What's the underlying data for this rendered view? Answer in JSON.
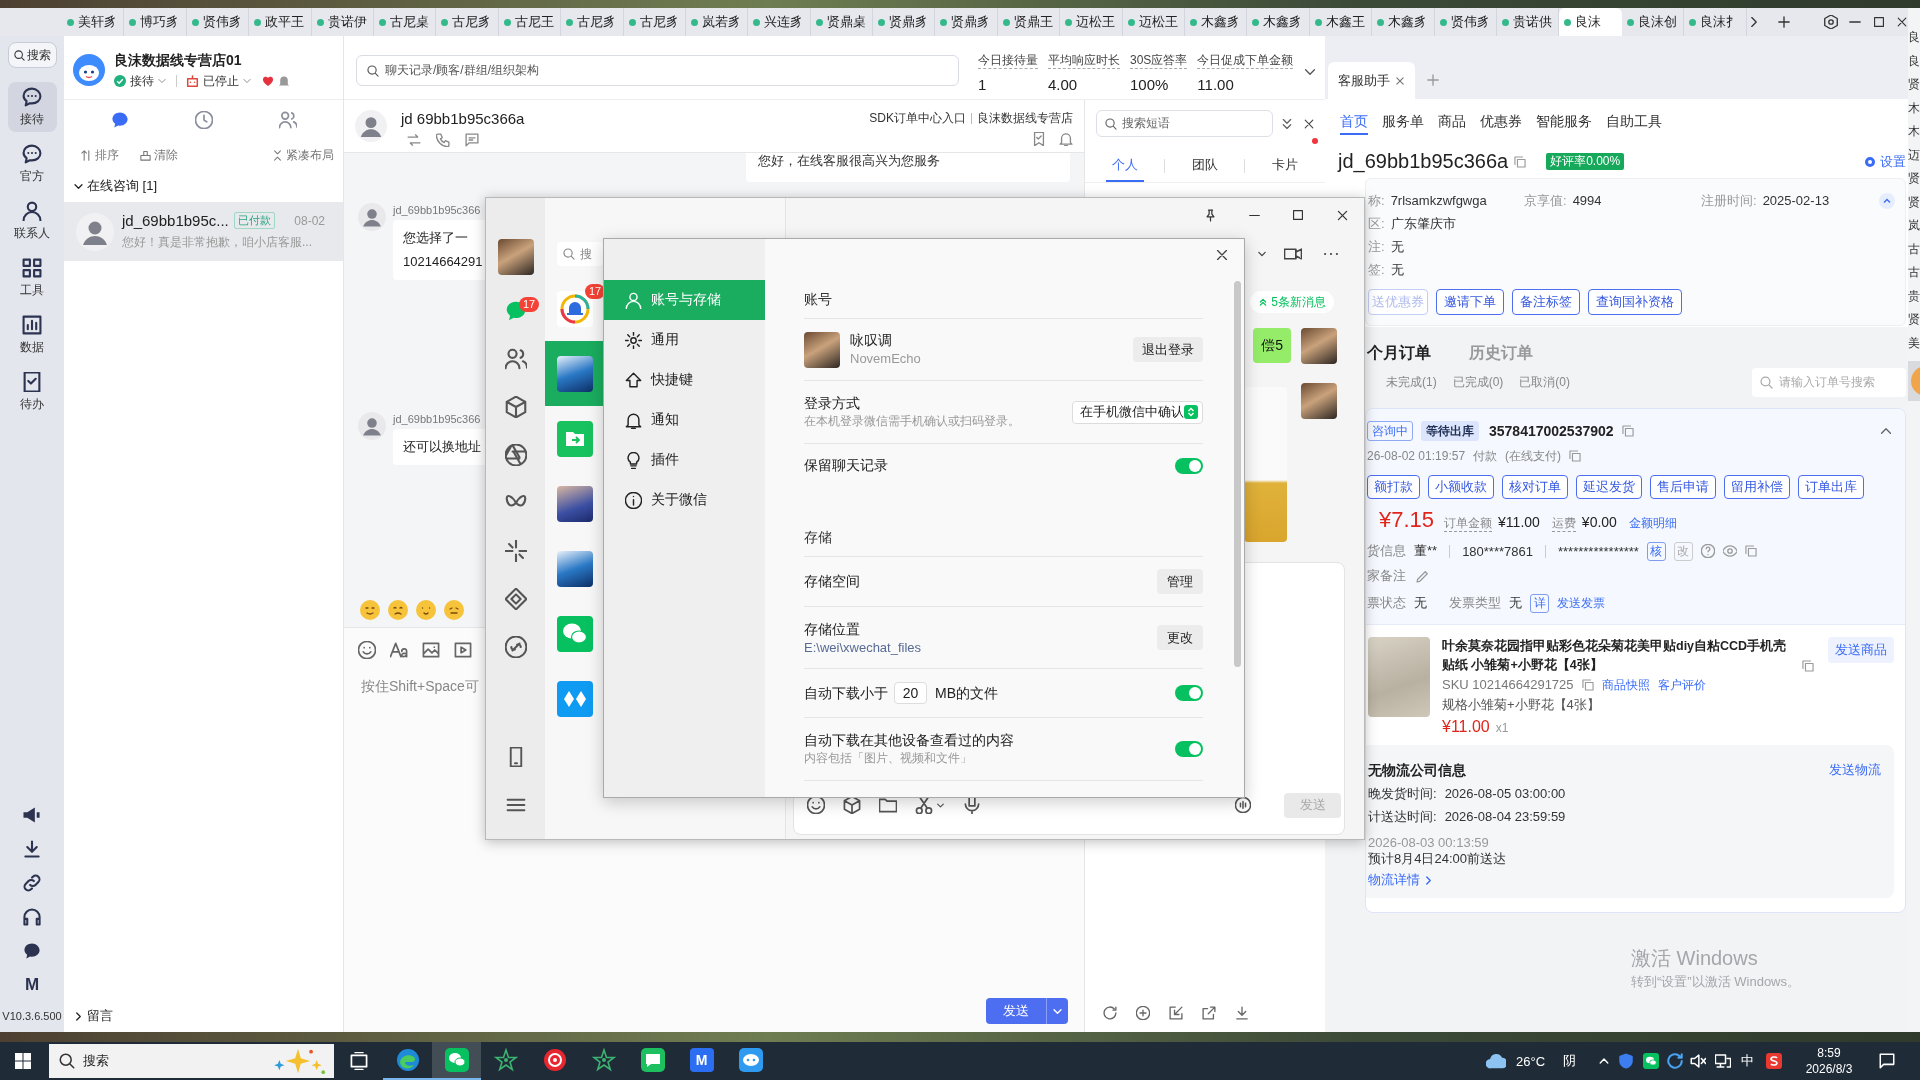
{
  "top_tabs": [
    {
      "label": "美轩豸",
      "selected": false
    },
    {
      "label": "博巧豸",
      "selected": false
    },
    {
      "label": "贤伟豸",
      "selected": false
    },
    {
      "label": "政平王",
      "selected": false
    },
    {
      "label": "贵诺伊",
      "selected": false
    },
    {
      "label": "古尼桌",
      "selected": false
    },
    {
      "label": "古尼豸",
      "selected": false
    },
    {
      "label": "古尼王",
      "selected": false
    },
    {
      "label": "古尼豸",
      "selected": false
    },
    {
      "label": "古尼豸",
      "selected": false
    },
    {
      "label": "岚若豸",
      "selected": false
    },
    {
      "label": "兴连豸",
      "selected": false
    },
    {
      "label": "贤鼎桌",
      "selected": false
    },
    {
      "label": "贤鼎豸",
      "selected": false
    },
    {
      "label": "贤鼎豸",
      "selected": false
    },
    {
      "label": "贤鼎王",
      "selected": false
    },
    {
      "label": "迈松王",
      "selected": false
    },
    {
      "label": "迈松王",
      "selected": false
    },
    {
      "label": "木鑫豸",
      "selected": false
    },
    {
      "label": "木鑫豸",
      "selected": false
    },
    {
      "label": "木鑫王",
      "selected": false
    },
    {
      "label": "木鑫豸",
      "selected": false
    },
    {
      "label": "贤伟豸",
      "selected": false
    },
    {
      "label": "贵诺供",
      "selected": false
    },
    {
      "label": "良沫",
      "selected": true
    },
    {
      "label": "良沫创",
      "selected": false
    },
    {
      "label": "良沫扌",
      "selected": false
    }
  ],
  "nav": {
    "search": "搜索",
    "items": [
      {
        "label": "接待",
        "selected": true
      },
      {
        "label": "官方",
        "selected": false
      },
      {
        "label": "联系人",
        "selected": false
      },
      {
        "label": "工具",
        "selected": false
      },
      {
        "label": "数据",
        "selected": false
      },
      {
        "label": "待办",
        "selected": false
      }
    ],
    "mark": "M",
    "version": "V10.3.6.500"
  },
  "store": {
    "name": "良沫数据线专营店01",
    "reception": "接待",
    "robot": "已停止"
  },
  "conversation_tabs": [
    {
      "selected": true
    },
    {
      "selected": false
    },
    {
      "selected": false
    }
  ],
  "list_actions": [
    "排序",
    "清除",
    "紧凑布局"
  ],
  "groups": [
    {
      "title": "在线咨询 [1]",
      "expanded": true,
      "conversations": [
        {
          "name": "jd_69bb1b95c...",
          "tag": "已付款",
          "date": "08-02",
          "preview": "您好！真是非常抱歉，咱小店客服...",
          "selected": true
        }
      ]
    },
    {
      "title": "留言",
      "expanded": false
    }
  ],
  "workbench": {
    "search_placeholder": "聊天记录/顾客/群组/组织架构",
    "metrics": [
      {
        "label": "今日接待量",
        "value": "1"
      },
      {
        "label": "平均响应时长",
        "value": "4.00"
      },
      {
        "label": "30S应答率",
        "value": "100%"
      },
      {
        "label": "今日促成下单金额",
        "value": "11.00"
      }
    ]
  },
  "chat": {
    "customer": "jd 69bb1b95c366a",
    "links": [
      "SDK订单中心入口",
      "良沫数据线专营店"
    ],
    "messages": [
      {
        "kind": "agent",
        "lines": [
          "您好，在线客服很高兴为您服务"
        ]
      },
      {
        "kind": "customer",
        "sender": "jd_69bb1b95c366",
        "lines": [
          "您选择了一",
          "10214664291"
        ]
      },
      {
        "kind": "customer",
        "sender": "jd_69bb1b95c366",
        "lines": [
          "还可以换地址"
        ]
      }
    ],
    "placeholder": "按住Shift+Space可",
    "send": "发送"
  },
  "phrases": {
    "placeholder": "搜索短语",
    "tabs": [
      {
        "label": "个人",
        "selected": true,
        "dot": false
      },
      {
        "label": "团队",
        "selected": false,
        "dot": false
      },
      {
        "label": "卡片",
        "selected": false,
        "dot": true
      }
    ]
  },
  "assistant": {
    "tabs": [
      {
        "label": "客服助手",
        "selected": true
      }
    ],
    "nav": [
      {
        "label": "首页",
        "selected": true
      },
      {
        "label": "服务单",
        "selected": false
      },
      {
        "label": "商品",
        "selected": false
      },
      {
        "label": "优惠券",
        "selected": false
      },
      {
        "label": "智能服务",
        "selected": false
      },
      {
        "label": "自助工具",
        "selected": false
      }
    ],
    "customer_id": "jd_69bb1b95c366a",
    "rating": "好评率0.00%",
    "setting": {
      "label": "设置",
      "on": true
    },
    "info_rows": [
      [
        {
          "label": "称:",
          "value": "7rlsamkzwfgwga"
        },
        {
          "label": "京享值:",
          "value": "4994"
        },
        {
          "label": "注册时间:",
          "value": "2025-02-13"
        }
      ],
      [
        {
          "label": "区:",
          "value": "广东肇庆市"
        }
      ],
      [
        {
          "label": "注:",
          "value": "无"
        }
      ],
      [
        {
          "label": "签:",
          "value": "无"
        }
      ]
    ],
    "info_expanded": true,
    "actions": [
      {
        "label": "送优惠券",
        "disabled": true
      },
      {
        "label": "邀请下单",
        "disabled": false
      },
      {
        "label": "备注标签",
        "disabled": false
      },
      {
        "label": "查询国补资格",
        "disabled": false
      }
    ],
    "order_tabs": [
      {
        "label": "个月订单",
        "selected": true
      },
      {
        "label": "历史订单",
        "selected": false
      }
    ],
    "order_filters": [
      {
        "label": "未完成(1)",
        "selected": false
      },
      {
        "label": "已完成(0)",
        "selected": false
      },
      {
        "label": "已取消(0)",
        "selected": false
      }
    ],
    "order_search": "请输入订单号搜索",
    "order": {
      "expanded": true,
      "tags": [
        {
          "label": "咨询中",
          "kind": "outline"
        },
        {
          "label": "等待出库",
          "kind": "filled"
        }
      ],
      "number": "3578417002537902",
      "paid_time": "26-08-02 01:19:57",
      "pay_status": "付款",
      "pay_method": "(在线支付)",
      "buttons": [
        "额打款",
        "小额收款",
        "核对订单",
        "延迟发货",
        "售后申请",
        "留用补偿",
        "订单出库"
      ],
      "paid": "¥7.15",
      "amount_label": "订单金额",
      "amount": "¥11.00",
      "shipping_label": "运费",
      "shipping": "¥0.00",
      "amount_detail": "金额明细",
      "receiver_label": "货信息",
      "receiver": "董**",
      "phone": "180****7861",
      "address": "****************",
      "verify": "核",
      "edit": "改",
      "remark_label": "家备注",
      "invoice_status_label": "票状态",
      "invoice_status": "无",
      "invoice_type_label": "发票类型",
      "invoice_type": "无",
      "invoice_detail": "详",
      "send_invoice": "发送发票",
      "product": {
        "title": "叶余莫奈花园指甲贴彩色花朵菊花美甲贴diy自粘CCD手机壳贴纸 小雏菊+小野花【4张】",
        "send": "发送商品",
        "sku": "SKU 10214664291725",
        "snapshot": "商品快照",
        "review": "客户评价",
        "spec": "规格小雏菊+小野花【4张】",
        "price": "¥11.00",
        "quantity": "x1"
      },
      "logistics": {
        "title": "无物流公司信息",
        "send": "发送物流",
        "rows": [
          {
            "label": "晚发货时间:",
            "value": "2026-08-05 03:00:00"
          },
          {
            "label": "计送达时间:",
            "value": "2026-08-04 23:59:59"
          }
        ],
        "time": "2026-08-03 00:13:59",
        "estimate": "预计8月4日24:00前送达",
        "detail": "物流详情"
      }
    }
  },
  "wechat": {
    "sidebar": [
      {
        "selected": true,
        "badge": "17"
      },
      {
        "selected": false
      },
      {
        "selected": false
      },
      {
        "selected": false
      },
      {
        "selected": false
      },
      {
        "selected": false
      },
      {
        "selected": false
      },
      {
        "selected": false
      }
    ],
    "search": "搜",
    "chats": [
      {
        "kind": "bell",
        "badge": "17",
        "selected": false
      },
      {
        "kind": "photo",
        "selected": true
      },
      {
        "kind": "folder",
        "selected": false
      },
      {
        "kind": "photo",
        "selected": false
      },
      {
        "kind": "photo",
        "selected": false
      },
      {
        "kind": "wechat",
        "selected": false
      },
      {
        "kind": "tiles",
        "selected": false
      }
    ],
    "new_messages": "5条新消息",
    "bubble": "偿5",
    "send": "发送",
    "settings": {
      "menu": [
        {
          "label": "账号与存储",
          "selected": true
        },
        {
          "label": "通用",
          "selected": false
        },
        {
          "label": "快捷键",
          "selected": false
        },
        {
          "label": "通知",
          "selected": false
        },
        {
          "label": "插件",
          "selected": false
        },
        {
          "label": "关于微信",
          "selected": false
        }
      ],
      "content": [
        {
          "kind": "heading",
          "label": "账号"
        },
        {
          "kind": "profile",
          "name": "咏叹调",
          "id": "NovemEcho",
          "button": "退出登录"
        },
        {
          "kind": "select",
          "label": "登录方式",
          "description": "在本机登录微信需手机确认或扫码登录。",
          "value": "在手机微信中确认"
        },
        {
          "kind": "toggle",
          "label": "保留聊天记录",
          "on": true
        },
        {
          "kind": "heading",
          "label": "存储"
        },
        {
          "kind": "button",
          "label": "存储空间",
          "button": "管理"
        },
        {
          "kind": "button",
          "label": "存储位置",
          "description": "E:\\wei\\xwechat_files",
          "button": "更改"
        },
        {
          "kind": "limit",
          "before": "自动下载小于",
          "value": "20",
          "after": "MB的文件",
          "on": true
        },
        {
          "kind": "toggle",
          "label": "自动下载在其他设备查看过的内容",
          "description": "内容包括「图片、视频和文件」",
          "on": true
        }
      ]
    }
  },
  "activation_notice": {
    "title": "激活 Windows",
    "text": "转到“设置”以激活 Windows。"
  },
  "side_window": {
    "labels": [
      "良",
      "良",
      "贤",
      "木",
      "木",
      "迈",
      "贤",
      "贤",
      "岚",
      "古",
      "古",
      "贵",
      "贤",
      "美"
    ]
  },
  "taskbar": {
    "search": "搜索",
    "apps": [
      {
        "kind": "edge",
        "selected": false,
        "running": true
      },
      {
        "kind": "wechat",
        "selected": true,
        "running": true
      },
      {
        "kind": "star",
        "selected": false,
        "running": false
      },
      {
        "kind": "record",
        "selected": false,
        "running": false
      },
      {
        "kind": "star",
        "selected": false,
        "running": false
      },
      {
        "kind": "message",
        "selected": false,
        "running": false
      },
      {
        "kind": "letter",
        "label": "M",
        "selected": false,
        "running": false
      },
      {
        "kind": "chat",
        "selected": false,
        "running": false
      }
    ],
    "temperature": "26°C",
    "weather": "阴",
    "input_method": "中",
    "time": "8:59",
    "date": "2026/8/3"
  }
}
